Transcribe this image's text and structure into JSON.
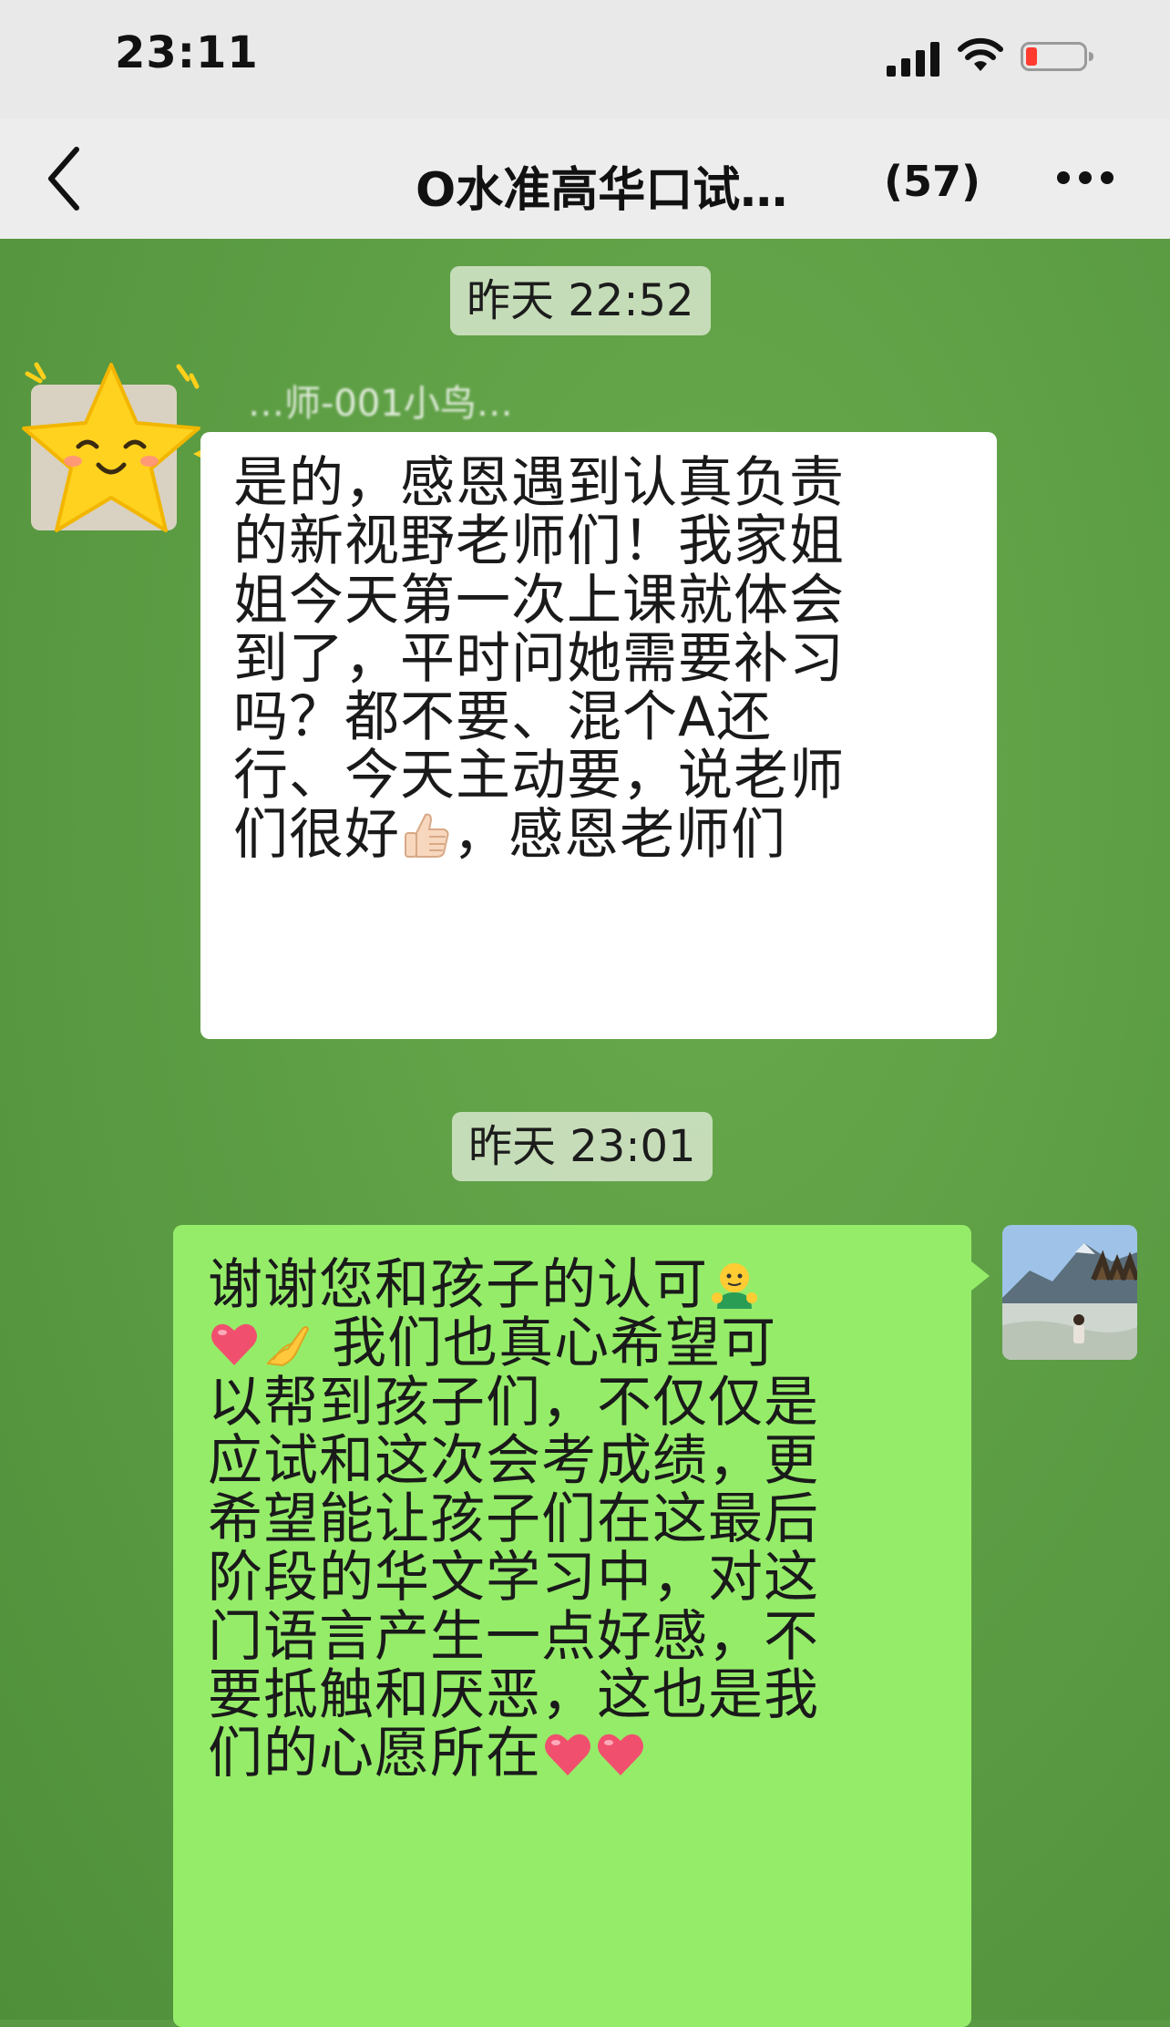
{
  "status_bar": {
    "time": "23:11",
    "icons": [
      "cellular-signal-icon",
      "wifi-icon",
      "battery-low-icon"
    ],
    "battery_color": "#ff3b30"
  },
  "nav": {
    "back_icon": "chevron-left-icon",
    "title": "O水准高华口试…",
    "member_count": "(57)",
    "more_icon": "more-dots-icon"
  },
  "chat": {
    "timestamps": [
      "昨天 22:52",
      "昨天 23:01"
    ],
    "incoming": {
      "sender_name": "…师-001小鸟…",
      "avatar": "star-sticker-avatar",
      "lines": [
        "是的，感恩遇到认真负责",
        "的新视野老师们！我家姐",
        "姐今天第一次上课就体会",
        "到了，平时问她需要补习",
        "吗？都不要、混个A还",
        "行、今天主动要，说老师"
      ],
      "last_line_before": "们很好",
      "last_line_after": "，感恩老师们",
      "emoji": "thumbs-up-emoji"
    },
    "outgoing": {
      "avatar": "mountain-photo-avatar",
      "line1": "谢谢您和孩子的认可",
      "line2": "我们也真心希望可",
      "lines": [
        "以帮到孩子们，不仅仅是",
        "应试和这次会考成绩，更",
        "希望能让孩子们在这最后",
        "阶段的华文学习中，对这",
        "门语言产生一点好感，不",
        "要抵触和厌恶，这也是我"
      ],
      "last_line": "们的心愿所在",
      "emojis": [
        "hug-emoji",
        "heart-emoji",
        "ok-hand-emoji",
        "heart-emoji",
        "heart-emoji"
      ]
    },
    "colors": {
      "incoming_bubble": "#ffffff",
      "outgoing_bubble": "#95ec69",
      "heart": "#f0506e"
    }
  }
}
